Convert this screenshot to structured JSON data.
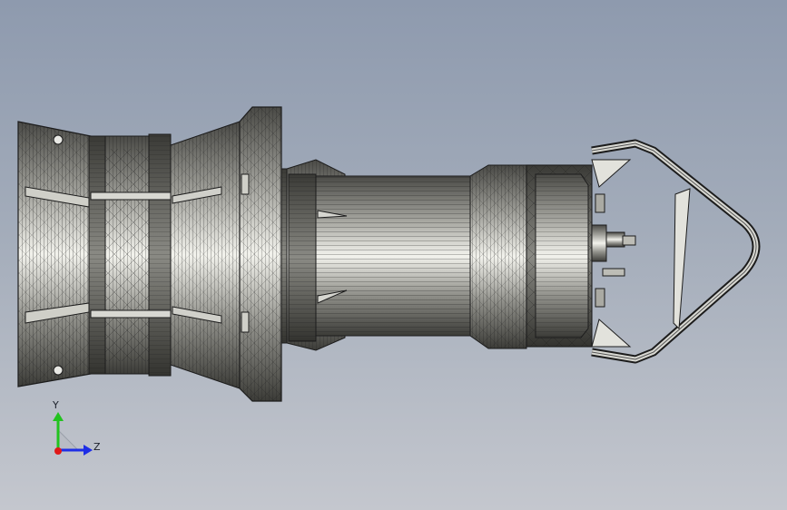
{
  "viewport": {
    "background_top": "#8e9aae",
    "background_bottom": "#c4c7ce"
  },
  "triad": {
    "y_label": "Y",
    "z_label": "Z",
    "y_color": "#22c31f",
    "z_color": "#1e2ee6",
    "x_color": "#e01818"
  },
  "model": {
    "name": "submersible-pump-assembly",
    "body_color": "#8a8a84",
    "highlight_color": "#f2f2ec",
    "edge_color": "#1c1c1c"
  }
}
